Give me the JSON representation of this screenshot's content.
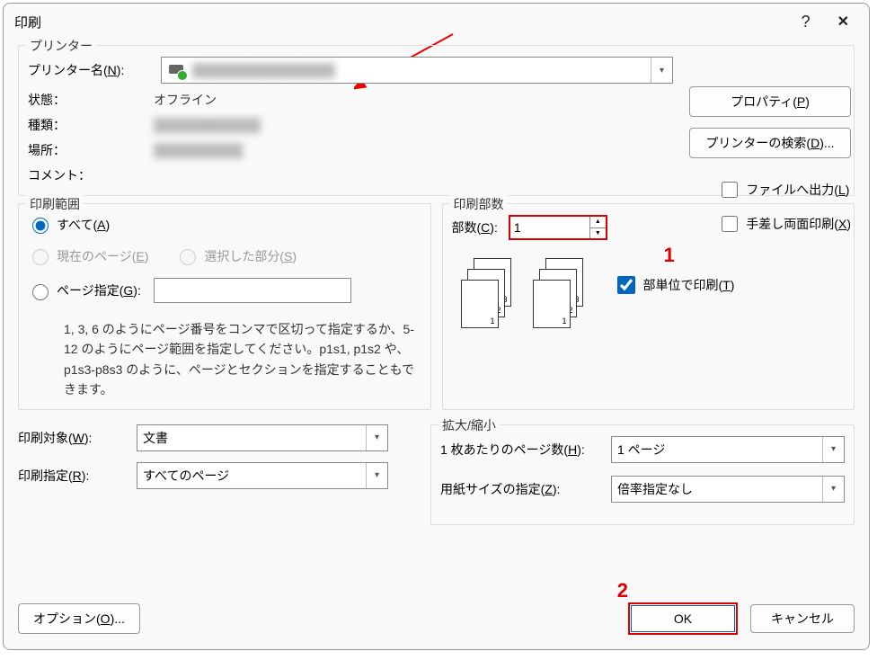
{
  "title": "印刷",
  "printerGroup": {
    "title": "プリンター",
    "nameLabelPre": "プリンター名(",
    "nameKey": "N",
    "nameLabelPost": "):",
    "selected": "████████████████",
    "statusLabel": "状態：",
    "statusValue": "オフライン",
    "typeLabel": "種類：",
    "typeValue": "████████████",
    "locationLabel": "場所：",
    "locationValue": "██████████",
    "commentLabel": "コメント：",
    "commentValue": ""
  },
  "propertiesBtnPre": "プロパティ(",
  "propertiesKey": "P",
  "propertiesBtnPost": ")",
  "findPrinterPre": "プリンターの検索(",
  "findPrinterKey": "D",
  "findPrinterPost": ")...",
  "fileOutPre": "ファイルへ出力(",
  "fileOutKey": "L",
  "fileOutPost": ")",
  "manualDuplexPre": "手差し両面印刷(",
  "manualDuplexKey": "X",
  "manualDuplexPost": ")",
  "rangeGroup": {
    "title": "印刷範囲",
    "allPre": "すべて(",
    "allKey": "A",
    "allPost": ")",
    "currentPre": "現在のページ(",
    "currentKey": "E",
    "currentPost": ")",
    "selectionPre": "選択した部分(",
    "selectionKey": "S",
    "selectionPost": ")",
    "pagesPre": "ページ指定(",
    "pagesKey": "G",
    "pagesPost": "):",
    "hint": "1, 3, 6 のようにページ番号をコンマで区切って指定するか、5-12 のようにページ範囲を指定してください。p1s1, p1s2 や、p1s3-p8s3 のように、ページとセクションを指定することもできます。"
  },
  "copiesGroup": {
    "title": "印刷部数",
    "copiesPre": "部数(",
    "copiesKey": "C",
    "copiesPost": "):",
    "copiesValue": "1",
    "collatePre": "部単位で印刷(",
    "collateKey": "T",
    "collatePost": ")"
  },
  "printWhatPre": "印刷対象(",
  "printWhatKey": "W",
  "printWhatPost": "):",
  "printWhatValue": "文書",
  "printPre": "印刷指定(",
  "printKey": "R",
  "printPost": "):",
  "printValue": "すべてのページ",
  "zoomGroup": {
    "title": "拡大/縮小",
    "pagesPerSheetPre": "1 枚あたりのページ数(",
    "pagesPerSheetKey": "H",
    "pagesPerSheetPost": "):",
    "pagesPerSheetValue": "1 ページ",
    "scalePre": "用紙サイズの指定(",
    "scaleKey": "Z",
    "scalePost": "):",
    "scaleValue": "倍率指定なし"
  },
  "optionsPre": "オプション(",
  "optionsKey": "O",
  "optionsPost": ")...",
  "okLabel": "OK",
  "cancelLabel": "キャンセル",
  "annot1": "1",
  "annot2": "2",
  "stackNums": {
    "n1": "1",
    "n2": "2",
    "n3": "3"
  }
}
